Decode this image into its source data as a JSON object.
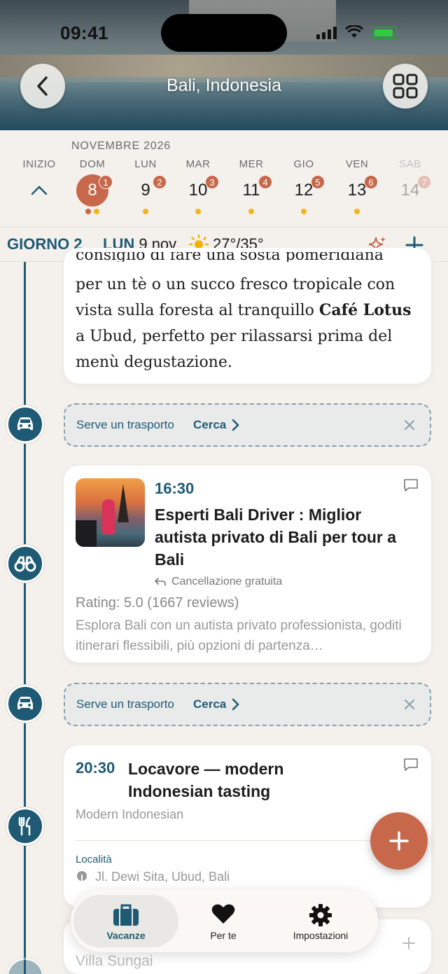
{
  "status": {
    "time": "09:41"
  },
  "header": {
    "title": "Bali, Indonesia"
  },
  "calendar": {
    "month": "NOVEMBRE 2026",
    "start_label": "INIZIO",
    "days": [
      {
        "dow": "DOM",
        "num": "8",
        "badge": "1",
        "selected": true
      },
      {
        "dow": "LUN",
        "num": "9",
        "badge": "2"
      },
      {
        "dow": "MAR",
        "num": "10",
        "badge": "3"
      },
      {
        "dow": "MER",
        "num": "11",
        "badge": "4"
      },
      {
        "dow": "GIO",
        "num": "12",
        "badge": "5"
      },
      {
        "dow": "VEN",
        "num": "13",
        "badge": "6"
      },
      {
        "dow": "SAB",
        "num": "14",
        "badge": "7"
      }
    ]
  },
  "day_header": {
    "day_label": "GIORNO 2",
    "weekday": "LUN",
    "date": "9 nov",
    "temperature": "27°/35°"
  },
  "text_card": {
    "cut_line": "consiglio di fare una sosta pomeridiana",
    "line1": "per un tè o un succo fresco tropicale con",
    "line2_prefix": "vista sulla foresta al tranquillo ",
    "line2_bold": "Café Lotus",
    "line3": "a Ubud, perfetto per rilassarsi prima del",
    "line4": "menù degustazione."
  },
  "transport": {
    "label": "Serve un trasporto",
    "link": "Cerca"
  },
  "tour": {
    "time": "16:30",
    "title": "Esperti Bali Driver : Miglior autista privato di Bali per tour a Bali",
    "cancel": "Cancellazione gratuita",
    "rating": "Rating: 5.0 (1667 reviews)",
    "description": "Esplora Bali con un autista privato professionista, goditi itinerari flessibili, più opzioni di partenza…"
  },
  "restaurant": {
    "time": "20:30",
    "title": "Locavore — modern Indonesian tasting",
    "subtitle": "Modern Indonesian",
    "location_label": "Località",
    "location": "Jl. Dewi Sita, Ubud, Bali"
  },
  "villa": {
    "title": "Villa Sungai"
  },
  "tabbar": {
    "tabs": [
      {
        "label": "Vacanze"
      },
      {
        "label": "Per te"
      },
      {
        "label": "Impostazioni"
      }
    ]
  },
  "colors": {
    "accent": "#1f5a74",
    "brand": "#c8684b",
    "background": "#f4f1ed"
  }
}
